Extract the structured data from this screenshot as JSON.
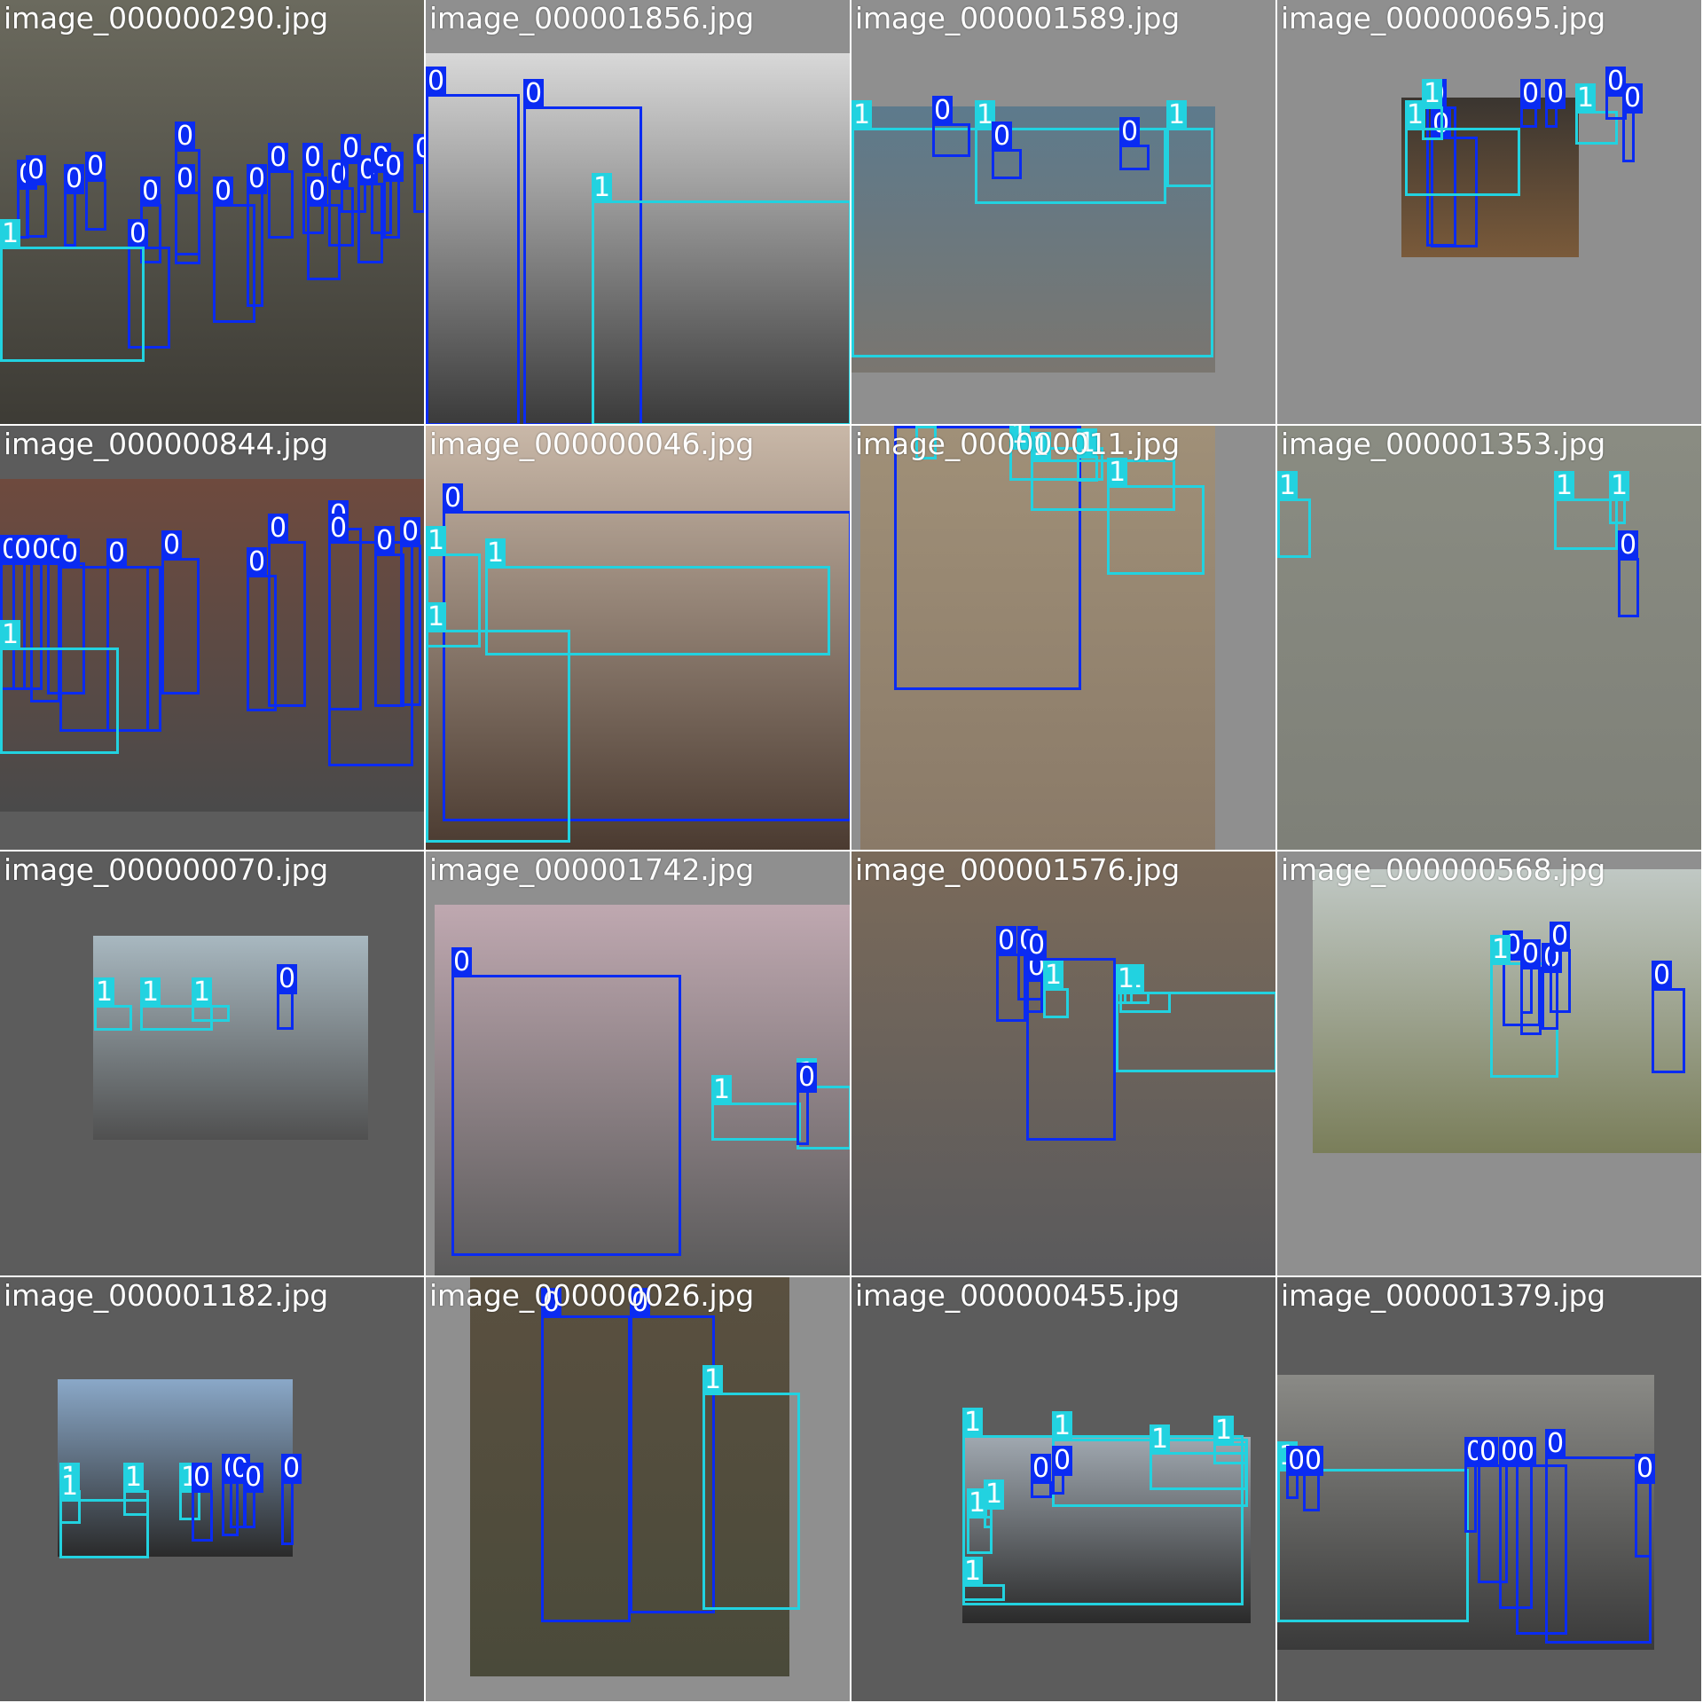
{
  "colors": {
    "class_0": "#0a2bf2",
    "class_1": "#22d2e0",
    "bg_dark": "#5c5c5c",
    "bg_light": "#8f8f8f"
  },
  "class_names": [
    "0",
    "1"
  ],
  "tiles": [
    {
      "filename": "image_000000290.jpg",
      "bg": "#8f8f8f",
      "photo_tone": [
        "#6b6a5e",
        "#3d3b35"
      ],
      "boxes": [
        {
          "c": 0,
          "b": [
            0.04,
            0.44,
            0.07,
            0.56
          ]
        },
        {
          "c": 0,
          "b": [
            0.06,
            0.43,
            0.11,
            0.56
          ]
        },
        {
          "c": 0,
          "b": [
            0.15,
            0.45,
            0.18,
            0.58
          ]
        },
        {
          "c": 0,
          "b": [
            0.2,
            0.42,
            0.25,
            0.54
          ]
        },
        {
          "c": 0,
          "b": [
            0.33,
            0.48,
            0.38,
            0.62
          ]
        },
        {
          "c": 0,
          "b": [
            0.41,
            0.35,
            0.47,
            0.6
          ]
        },
        {
          "c": 0,
          "b": [
            0.41,
            0.45,
            0.47,
            0.62
          ]
        },
        {
          "c": 0,
          "b": [
            0.5,
            0.48,
            0.6,
            0.76
          ]
        },
        {
          "c": 0,
          "b": [
            0.58,
            0.45,
            0.62,
            0.72
          ]
        },
        {
          "c": 0,
          "b": [
            0.63,
            0.4,
            0.69,
            0.56
          ]
        },
        {
          "c": 0,
          "b": [
            0.71,
            0.4,
            0.76,
            0.55
          ]
        },
        {
          "c": 0,
          "b": [
            0.72,
            0.48,
            0.8,
            0.66
          ]
        },
        {
          "c": 0,
          "b": [
            0.77,
            0.44,
            0.83,
            0.58
          ]
        },
        {
          "c": 0,
          "b": [
            0.8,
            0.38,
            0.86,
            0.5
          ]
        },
        {
          "c": 0,
          "b": [
            0.84,
            0.43,
            0.9,
            0.62
          ]
        },
        {
          "c": 0,
          "b": [
            0.87,
            0.4,
            0.92,
            0.55
          ]
        },
        {
          "c": 0,
          "b": [
            0.9,
            0.42,
            0.94,
            0.56
          ]
        },
        {
          "c": 0,
          "b": [
            0.97,
            0.38,
            1.0,
            0.5
          ]
        },
        {
          "c": 0,
          "b": [
            0.3,
            0.58,
            0.4,
            0.82
          ]
        },
        {
          "c": 1,
          "b": [
            0.0,
            0.58,
            0.34,
            0.85
          ]
        }
      ]
    },
    {
      "filename": "image_000001856.jpg",
      "bg": "#8f8f8f",
      "photo_tone": [
        "#d8d8d8",
        "#3a3a3a"
      ],
      "boxes": [
        {
          "c": 0,
          "b": [
            0.0,
            0.22,
            0.22,
            1.0
          ]
        },
        {
          "c": 0,
          "b": [
            0.23,
            0.25,
            0.51,
            1.0
          ]
        },
        {
          "c": 1,
          "b": [
            0.39,
            0.47,
            1.0,
            1.0
          ]
        }
      ]
    },
    {
      "filename": "image_000001589.jpg",
      "bg": "#8f8f8f",
      "photo_tone": [
        "#5d7a8c",
        "#7a7670"
      ],
      "boxes": [
        {
          "c": 1,
          "b": [
            0.0,
            0.3,
            0.85,
            0.84
          ]
        },
        {
          "c": 0,
          "b": [
            0.19,
            0.29,
            0.28,
            0.37
          ]
        },
        {
          "c": 1,
          "b": [
            0.29,
            0.3,
            0.74,
            0.48
          ]
        },
        {
          "c": 0,
          "b": [
            0.33,
            0.35,
            0.4,
            0.42
          ]
        },
        {
          "c": 0,
          "b": [
            0.63,
            0.34,
            0.7,
            0.4
          ]
        },
        {
          "c": 1,
          "b": [
            0.74,
            0.3,
            0.85,
            0.44
          ]
        }
      ]
    },
    {
      "filename": "image_000000695.jpg",
      "bg": "#8f8f8f",
      "photo_tone": [
        "#3a3530",
        "#7a5a3a"
      ],
      "boxes": [
        {
          "c": 0,
          "b": [
            0.35,
            0.25,
            0.42,
            0.58
          ]
        },
        {
          "c": 0,
          "b": [
            0.36,
            0.32,
            0.47,
            0.58
          ]
        },
        {
          "c": 1,
          "b": [
            0.3,
            0.3,
            0.57,
            0.46
          ]
        },
        {
          "c": 1,
          "b": [
            0.34,
            0.25,
            0.39,
            0.33
          ]
        },
        {
          "c": 0,
          "b": [
            0.57,
            0.25,
            0.61,
            0.3
          ]
        },
        {
          "c": 0,
          "b": [
            0.63,
            0.25,
            0.66,
            0.3
          ]
        },
        {
          "c": 1,
          "b": [
            0.7,
            0.26,
            0.8,
            0.34
          ]
        },
        {
          "c": 0,
          "b": [
            0.77,
            0.22,
            0.82,
            0.28
          ]
        },
        {
          "c": 0,
          "b": [
            0.81,
            0.26,
            0.84,
            0.38
          ]
        }
      ]
    },
    {
      "filename": "image_000000844.jpg",
      "bg": "#5c5c5c",
      "photo_tone": [
        "#6e4a3e",
        "#4a4a4a"
      ],
      "boxes": [
        {
          "c": 0,
          "b": [
            0.0,
            0.32,
            0.06,
            0.62
          ]
        },
        {
          "c": 0,
          "b": [
            0.03,
            0.32,
            0.1,
            0.62
          ]
        },
        {
          "c": 0,
          "b": [
            0.07,
            0.32,
            0.14,
            0.65
          ]
        },
        {
          "c": 0,
          "b": [
            0.11,
            0.32,
            0.2,
            0.63
          ]
        },
        {
          "c": 0,
          "b": [
            0.14,
            0.33,
            0.35,
            0.72
          ]
        },
        {
          "c": 0,
          "b": [
            0.25,
            0.33,
            0.38,
            0.72
          ]
        },
        {
          "c": 0,
          "b": [
            0.38,
            0.31,
            0.47,
            0.63
          ]
        },
        {
          "c": 0,
          "b": [
            0.58,
            0.35,
            0.65,
            0.67
          ]
        },
        {
          "c": 0,
          "b": [
            0.63,
            0.27,
            0.72,
            0.66
          ]
        },
        {
          "c": 0,
          "b": [
            0.77,
            0.24,
            0.85,
            0.67
          ]
        },
        {
          "c": 0,
          "b": [
            0.77,
            0.27,
            0.97,
            0.8
          ]
        },
        {
          "c": 0,
          "b": [
            0.88,
            0.3,
            0.95,
            0.66
          ]
        },
        {
          "c": 0,
          "b": [
            0.94,
            0.28,
            0.99,
            0.66
          ]
        },
        {
          "c": 1,
          "b": [
            0.0,
            0.52,
            0.28,
            0.77
          ]
        }
      ]
    },
    {
      "filename": "image_000000046.jpg",
      "bg": "#8f8f8f",
      "photo_tone": [
        "#c9b8a8",
        "#4a3a30"
      ],
      "boxes": [
        {
          "c": 0,
          "b": [
            0.04,
            0.2,
            1.0,
            0.93
          ]
        },
        {
          "c": 1,
          "b": [
            0.0,
            0.3,
            0.13,
            0.52
          ]
        },
        {
          "c": 1,
          "b": [
            0.14,
            0.33,
            0.95,
            0.54
          ]
        },
        {
          "c": 1,
          "b": [
            0.0,
            0.48,
            0.34,
            0.98
          ]
        }
      ]
    },
    {
      "filename": "image_000000011.jpg",
      "bg": "#8f8f8f",
      "photo_tone": [
        "#a09078",
        "#8a7a68"
      ],
      "boxes": [
        {
          "c": 0,
          "b": [
            0.1,
            0.0,
            0.54,
            0.62
          ]
        },
        {
          "c": 1,
          "b": [
            0.15,
            0.0,
            0.2,
            0.08
          ]
        },
        {
          "c": 1,
          "b": [
            0.37,
            0.05,
            0.59,
            0.13
          ]
        },
        {
          "c": 1,
          "b": [
            0.42,
            0.08,
            0.76,
            0.2
          ]
        },
        {
          "c": 1,
          "b": [
            0.6,
            0.14,
            0.83,
            0.35
          ]
        },
        {
          "c": 1,
          "b": [
            0.53,
            0.07,
            0.58,
            0.13
          ]
        }
      ]
    },
    {
      "filename": "image_000001353.jpg",
      "bg": "#8f8f8f",
      "photo_tone": [
        "#8a8c82",
        "#7e8078"
      ],
      "boxes": [
        {
          "c": 1,
          "b": [
            0.0,
            0.17,
            0.08,
            0.31
          ]
        },
        {
          "c": 1,
          "b": [
            0.65,
            0.17,
            0.8,
            0.29
          ]
        },
        {
          "c": 1,
          "b": [
            0.78,
            0.17,
            0.82,
            0.23
          ]
        },
        {
          "c": 0,
          "b": [
            0.8,
            0.31,
            0.85,
            0.45
          ]
        }
      ]
    },
    {
      "filename": "image_000000070.jpg",
      "bg": "#5c5c5c",
      "photo_tone": [
        "#a8b8c0",
        "#505050"
      ],
      "boxes": [
        {
          "c": 1,
          "b": [
            0.22,
            0.36,
            0.31,
            0.42
          ]
        },
        {
          "c": 1,
          "b": [
            0.33,
            0.36,
            0.5,
            0.42
          ]
        },
        {
          "c": 1,
          "b": [
            0.45,
            0.36,
            0.54,
            0.4
          ]
        },
        {
          "c": 0,
          "b": [
            0.65,
            0.33,
            0.69,
            0.42
          ]
        }
      ]
    },
    {
      "filename": "image_000001742.jpg",
      "bg": "#8f8f8f",
      "photo_tone": [
        "#bfa8b0",
        "#5a5a5a"
      ],
      "boxes": [
        {
          "c": 0,
          "b": [
            0.06,
            0.29,
            0.6,
            0.95
          ]
        },
        {
          "c": 1,
          "b": [
            0.67,
            0.59,
            0.88,
            0.68
          ]
        },
        {
          "c": 1,
          "b": [
            0.87,
            0.55,
            1.0,
            0.7
          ]
        },
        {
          "c": 0,
          "b": [
            0.87,
            0.56,
            0.9,
            0.69
          ]
        }
      ]
    },
    {
      "filename": "image_000001576.jpg",
      "bg": "#5c5c5c",
      "photo_tone": [
        "#7a6a5a",
        "#5a5a5c"
      ],
      "boxes": [
        {
          "c": 0,
          "b": [
            0.34,
            0.24,
            0.41,
            0.4
          ]
        },
        {
          "c": 0,
          "b": [
            0.39,
            0.24,
            0.45,
            0.35
          ]
        },
        {
          "c": 0,
          "b": [
            0.41,
            0.3,
            0.45,
            0.38
          ]
        },
        {
          "c": 1,
          "b": [
            0.45,
            0.32,
            0.51,
            0.39
          ]
        },
        {
          "c": 0,
          "b": [
            0.41,
            0.25,
            0.62,
            0.68
          ]
        },
        {
          "c": 1,
          "b": [
            0.63,
            0.33,
            0.75,
            0.38
          ]
        },
        {
          "c": 1,
          "b": [
            0.64,
            0.33,
            0.7,
            0.36
          ]
        },
        {
          "c": 1,
          "b": [
            0.62,
            0.33,
            0.66,
            0.36
          ]
        },
        {
          "c": 1,
          "b": [
            0.62,
            0.33,
            1.0,
            0.52
          ]
        }
      ]
    },
    {
      "filename": "image_000000568.jpg",
      "bg": "#8f8f8f",
      "photo_tone": [
        "#c0c8c4",
        "#7a7e5a"
      ],
      "boxes": [
        {
          "c": 0,
          "b": [
            0.53,
            0.25,
            0.62,
            0.41
          ]
        },
        {
          "c": 0,
          "b": [
            0.57,
            0.27,
            0.6,
            0.38
          ]
        },
        {
          "c": 1,
          "b": [
            0.5,
            0.26,
            0.66,
            0.53
          ]
        },
        {
          "c": 0,
          "b": [
            0.57,
            0.27,
            0.62,
            0.43
          ]
        },
        {
          "c": 0,
          "b": [
            0.62,
            0.28,
            0.66,
            0.42
          ]
        },
        {
          "c": 0,
          "b": [
            0.64,
            0.23,
            0.69,
            0.38
          ]
        },
        {
          "c": 0,
          "b": [
            0.88,
            0.32,
            0.96,
            0.52
          ]
        }
      ]
    },
    {
      "filename": "image_000001182.jpg",
      "bg": "#5c5c5c",
      "photo_tone": [
        "#8aa8c8",
        "#2a2a2a"
      ],
      "boxes": [
        {
          "c": 1,
          "b": [
            0.14,
            0.5,
            0.19,
            0.58
          ]
        },
        {
          "c": 1,
          "b": [
            0.14,
            0.52,
            0.35,
            0.66
          ]
        },
        {
          "c": 1,
          "b": [
            0.29,
            0.5,
            0.35,
            0.56
          ]
        },
        {
          "c": 1,
          "b": [
            0.42,
            0.5,
            0.47,
            0.57
          ]
        },
        {
          "c": 0,
          "b": [
            0.45,
            0.5,
            0.5,
            0.62
          ]
        },
        {
          "c": 0,
          "b": [
            0.52,
            0.48,
            0.56,
            0.61
          ]
        },
        {
          "c": 0,
          "b": [
            0.54,
            0.48,
            0.58,
            0.59
          ]
        },
        {
          "c": 0,
          "b": [
            0.57,
            0.5,
            0.6,
            0.59
          ]
        },
        {
          "c": 0,
          "b": [
            0.66,
            0.48,
            0.69,
            0.63
          ]
        }
      ]
    },
    {
      "filename": "image_000000026.jpg",
      "bg": "#8f8f8f",
      "photo_tone": [
        "#5a5040",
        "#4a4a3a"
      ],
      "boxes": [
        {
          "c": 0,
          "b": [
            0.27,
            0.09,
            0.48,
            0.81
          ]
        },
        {
          "c": 0,
          "b": [
            0.48,
            0.09,
            0.68,
            0.79
          ]
        },
        {
          "c": 1,
          "b": [
            0.65,
            0.27,
            0.88,
            0.78
          ]
        }
      ]
    },
    {
      "filename": "image_000000455.jpg",
      "bg": "#5c5c5c",
      "photo_tone": [
        "#a0a8b0",
        "#2a2a2a"
      ],
      "boxes": [
        {
          "c": 1,
          "b": [
            0.26,
            0.37,
            0.92,
            0.77
          ]
        },
        {
          "c": 1,
          "b": [
            0.47,
            0.38,
            0.93,
            0.54
          ]
        },
        {
          "c": 1,
          "b": [
            0.7,
            0.41,
            0.93,
            0.5
          ]
        },
        {
          "c": 1,
          "b": [
            0.85,
            0.39,
            0.93,
            0.44
          ]
        },
        {
          "c": 1,
          "b": [
            0.27,
            0.56,
            0.33,
            0.65
          ]
        },
        {
          "c": 1,
          "b": [
            0.31,
            0.54,
            0.33,
            0.59
          ]
        },
        {
          "c": 1,
          "b": [
            0.26,
            0.72,
            0.36,
            0.76
          ]
        },
        {
          "c": 0,
          "b": [
            0.42,
            0.48,
            0.47,
            0.52
          ]
        },
        {
          "c": 0,
          "b": [
            0.47,
            0.46,
            0.5,
            0.51
          ]
        }
      ]
    },
    {
      "filename": "image_000001379.jpg",
      "bg": "#5c5c5c",
      "photo_tone": [
        "#8a8a86",
        "#3a3a3a"
      ],
      "boxes": [
        {
          "c": 1,
          "b": [
            0.0,
            0.45,
            0.45,
            0.81
          ]
        },
        {
          "c": 0,
          "b": [
            0.02,
            0.46,
            0.05,
            0.52
          ]
        },
        {
          "c": 0,
          "b": [
            0.06,
            0.46,
            0.1,
            0.55
          ]
        },
        {
          "c": 0,
          "b": [
            0.44,
            0.44,
            0.47,
            0.6
          ]
        },
        {
          "c": 0,
          "b": [
            0.47,
            0.44,
            0.54,
            0.72
          ]
        },
        {
          "c": 0,
          "b": [
            0.52,
            0.44,
            0.6,
            0.78
          ]
        },
        {
          "c": 0,
          "b": [
            0.56,
            0.44,
            0.68,
            0.84
          ]
        },
        {
          "c": 0,
          "b": [
            0.63,
            0.42,
            0.88,
            0.86
          ]
        },
        {
          "c": 0,
          "b": [
            0.84,
            0.48,
            0.88,
            0.66
          ]
        }
      ]
    }
  ]
}
